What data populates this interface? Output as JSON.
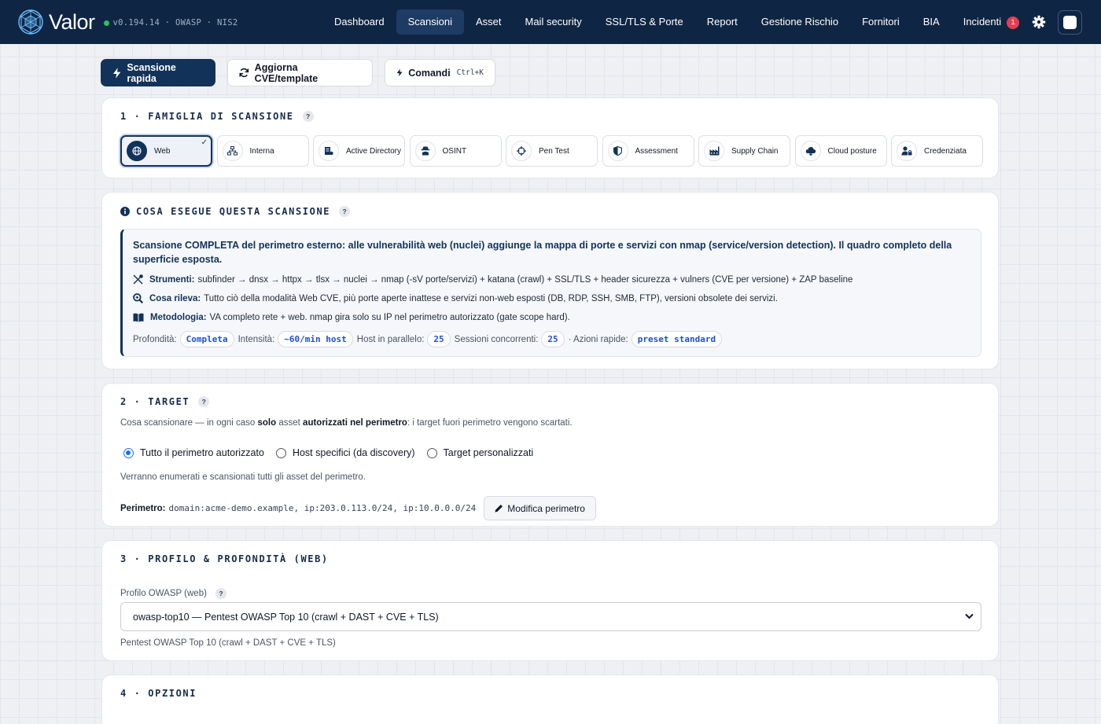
{
  "app": {
    "name": "Valor",
    "version": "v0.194.14 · OWASP · NIS2"
  },
  "nav": [
    {
      "label": "Dashboard"
    },
    {
      "label": "Scansioni"
    },
    {
      "label": "Asset"
    },
    {
      "label": "Mail security"
    },
    {
      "label": "SSL/TLS & Porte"
    },
    {
      "label": "Report"
    },
    {
      "label": "Gestione Rischio"
    },
    {
      "label": "Fornitori"
    },
    {
      "label": "BIA"
    },
    {
      "label": "Incidenti",
      "badge": "1"
    }
  ],
  "actions": {
    "quick_scan": "Scansione rapida",
    "update": "Aggiorna CVE/template",
    "commands": "Comandi",
    "commands_kbd": "Ctrl+K"
  },
  "family": {
    "title": "1 · FAMIGLIA DI SCANSIONE",
    "help": "?",
    "items": [
      {
        "label": "Web",
        "icon": "globe-icon"
      },
      {
        "label": "Interna",
        "icon": "network-icon"
      },
      {
        "label": "Active Directory",
        "icon": "server-icon"
      },
      {
        "label": "OSINT",
        "icon": "spy-icon"
      },
      {
        "label": "Pen Test",
        "icon": "crosshairs-icon"
      },
      {
        "label": "Assessment",
        "icon": "shield-icon"
      },
      {
        "label": "Supply Chain",
        "icon": "industry-icon"
      },
      {
        "label": "Cloud posture",
        "icon": "cloud-icon"
      },
      {
        "label": "Credenziata",
        "icon": "user-lock-icon"
      }
    ],
    "selected_check": "✓"
  },
  "info": {
    "title": "COSA ESEGUE QUESTA SCANSIONE",
    "help": "?",
    "lead": "Scansione COMPLETA del perimetro esterno: alle vulnerabilità web (nuclei) aggiunge la mappa di porte e servizi con nmap (service/version detection). Il quadro completo della superficie esposta.",
    "tools_label": "Strumenti:",
    "tools": "subfinder → dnsx → httpx → tlsx → nuclei → nmap (-sV porte/servizi) + katana (crawl) + SSL/TLS + header sicurezza + vulners (CVE per versione) + ZAP baseline",
    "detects_label": "Cosa rileva:",
    "detects": "Tutto ciò della modalità Web CVE, più porte aperte inattese e servizi non-web esposti (DB, RDP, SSH, SMB, FTP), versioni obsolete dei servizi.",
    "method_label": "Metodologia:",
    "method": "VA completo rete + web. nmap gira solo su IP nel perimetro autorizzato (gate scope hard).",
    "depth_label": "Profondità:",
    "depth": "Completa",
    "intensity_label": "Intensità:",
    "intensity": "~60/min host",
    "parallel_label": "Host in parallelo:",
    "parallel": "25",
    "sessions_label": "Sessioni concorrenti:",
    "sessions": "25",
    "quick_label": "· Azioni rapide:",
    "quick": "preset standard"
  },
  "target": {
    "title": "2 · TARGET",
    "help": "?",
    "desc_a": "Cosa scansionare — in ogni caso ",
    "desc_b": "solo",
    "desc_c": " asset ",
    "desc_d": "autorizzati nel perimetro",
    "desc_e": ": i target fuori perimetro vengono scartati.",
    "options": [
      "Tutto il perimetro autorizzato",
      "Host specifici (da discovery)",
      "Target personalizzati"
    ],
    "selected": 0,
    "note": "Verranno enumerati e scansionati tutti gli asset del perimetro.",
    "perimeter_label": "Perimetro:",
    "perimeter": "domain:acme-demo.example, ip:203.0.113.0/24, ip:10.0.0.0/24",
    "edit": "Modifica perimetro"
  },
  "profile": {
    "title": "3 · PROFILO & PROFONDITÀ (WEB)",
    "field_label": "Profilo OWASP (web)",
    "help": "?",
    "selected": "owasp-top10 — Pentest OWASP Top 10 (crawl + DAST + CVE + TLS)",
    "hint": "Pentest OWASP Top 10 (crawl + DAST + CVE + TLS)"
  },
  "options": {
    "title": "4 · OPZIONI"
  },
  "colors": {
    "navy": "#0f2544",
    "accent": "#12325a",
    "badge": "#e53e4f",
    "online": "#22c55e",
    "link": "#1d4ed8"
  }
}
